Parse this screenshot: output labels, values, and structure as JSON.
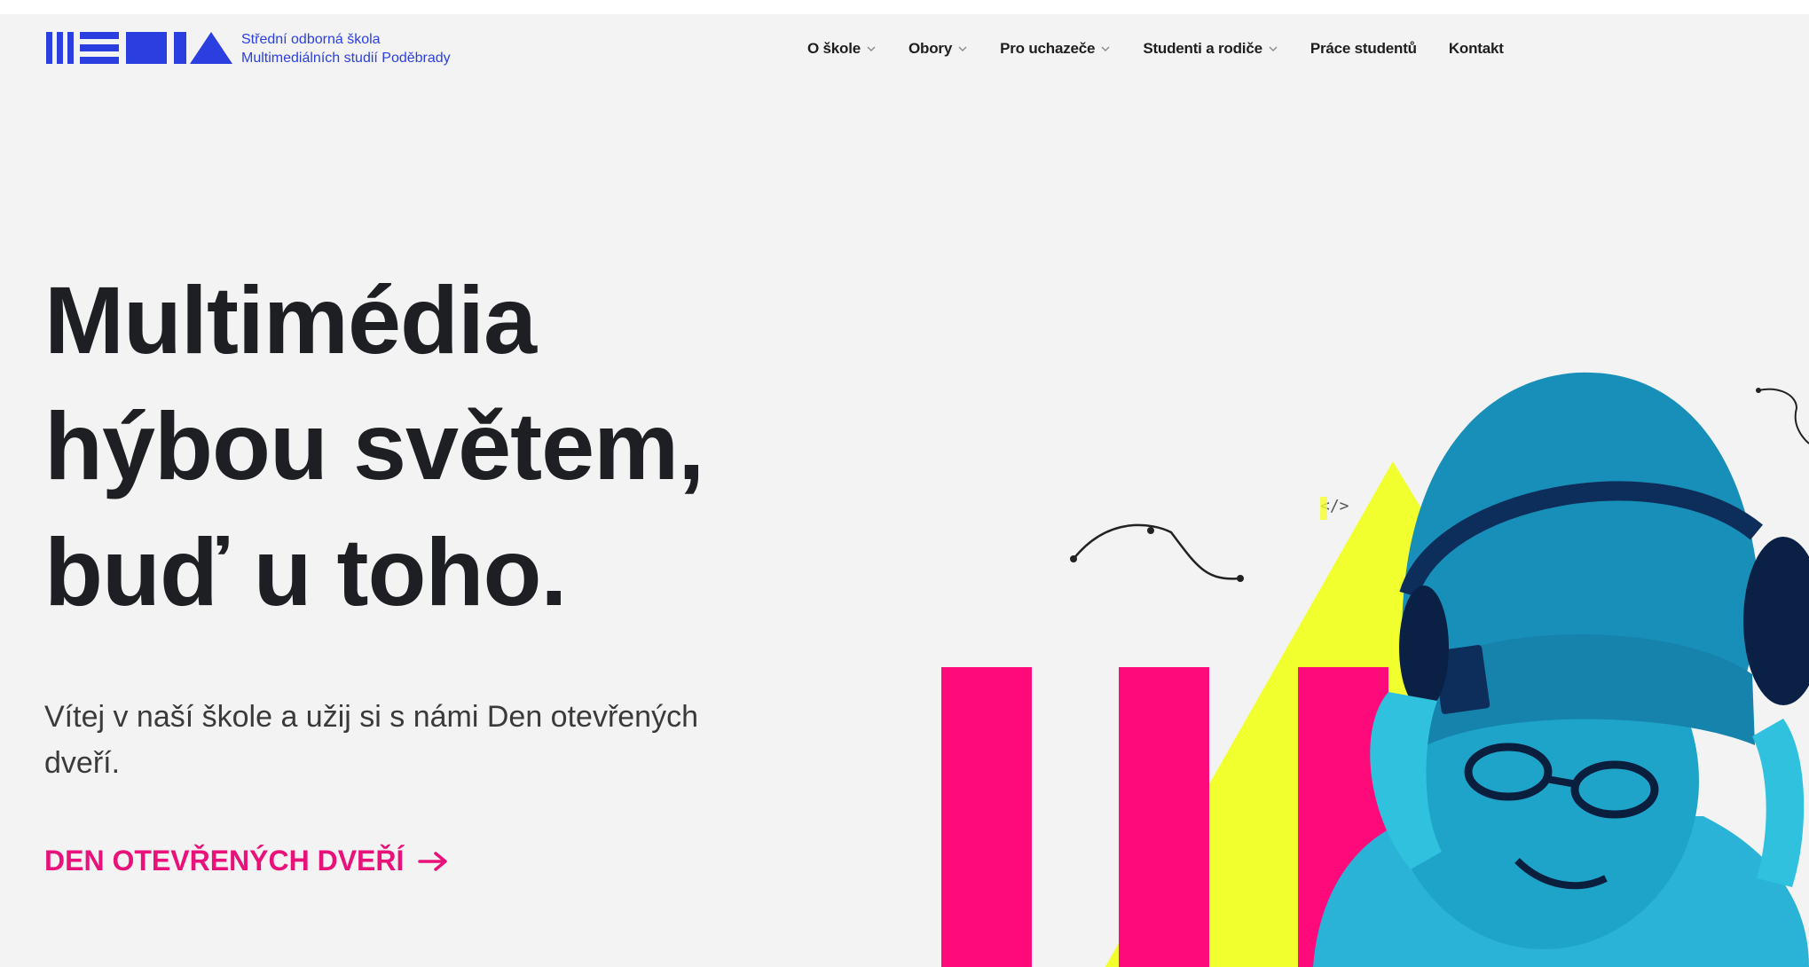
{
  "brand": {
    "line1": "Střední odborná škola",
    "line2": "Multimediálních studií Poděbrady",
    "color": "#2b3fe0"
  },
  "nav": [
    {
      "label": "O škole",
      "dropdown": true
    },
    {
      "label": "Obory",
      "dropdown": true
    },
    {
      "label": "Pro uchazeče",
      "dropdown": true
    },
    {
      "label": "Studenti a rodiče",
      "dropdown": true
    },
    {
      "label": "Práce studentů",
      "dropdown": false
    },
    {
      "label": "Kontakt",
      "dropdown": false
    }
  ],
  "hero": {
    "title_lines": [
      "Multimédia",
      "hýbou světem,",
      "buď u toho."
    ],
    "intro": "Vítej v naší škole a užij si s námi Den otevřených dveří.",
    "cta": "DEN OTEVŘENÝCH DVEŘÍ"
  },
  "art": {
    "code_tag": "</>"
  },
  "colors": {
    "accent_pink": "#ff0a7a",
    "accent_yellow": "#f2ff2e",
    "photo_tint": "#1aa6c8",
    "text_dark": "#1e1f23",
    "cta": "#e8127a"
  }
}
